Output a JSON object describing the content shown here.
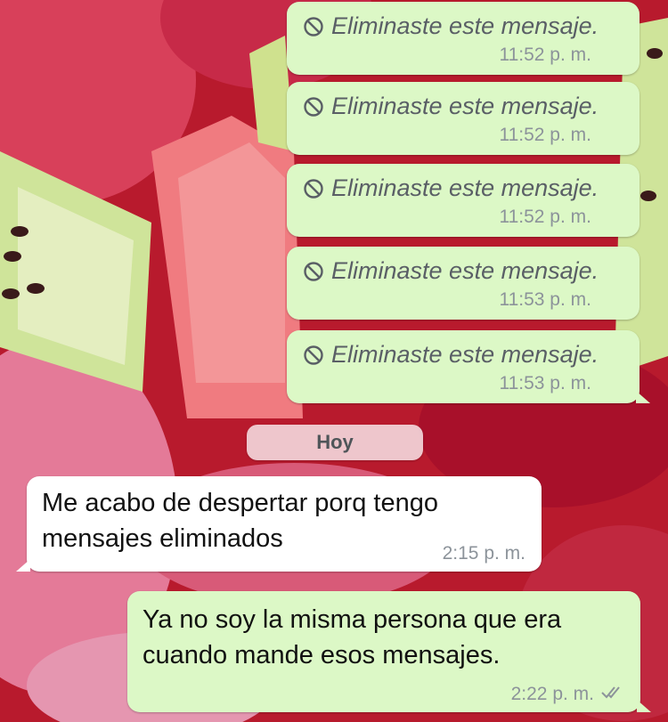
{
  "colors": {
    "outgoing_bubble": "#dcf8c6",
    "incoming_bubble": "#ffffff",
    "date_chip": "#f5dee2",
    "timestamp": "#8c939a",
    "deleted_text": "#5a5f66"
  },
  "icons": {
    "deleted": "ban-icon",
    "read_receipt": "double-check-icon"
  },
  "messages": {
    "deleted": [
      {
        "text": "Eliminaste este mensaje.",
        "time": "11:52 p. m."
      },
      {
        "text": "Eliminaste este mensaje.",
        "time": "11:52 p. m."
      },
      {
        "text": "Eliminaste este mensaje.",
        "time": "11:52 p. m."
      },
      {
        "text": "Eliminaste este mensaje.",
        "time": "11:53 p. m."
      },
      {
        "text": "Eliminaste este mensaje.",
        "time": "11:53 p. m."
      }
    ],
    "date_label": "Hoy",
    "incoming": {
      "line1": "Me acabo de despertar porq tengo",
      "line2": "mensajes eliminados",
      "time": "2:15 p. m."
    },
    "outgoing": {
      "line1": "Ya no soy la misma persona que era",
      "line2": "cuando mande esos mensajes.",
      "time": "2:22 p. m."
    }
  }
}
